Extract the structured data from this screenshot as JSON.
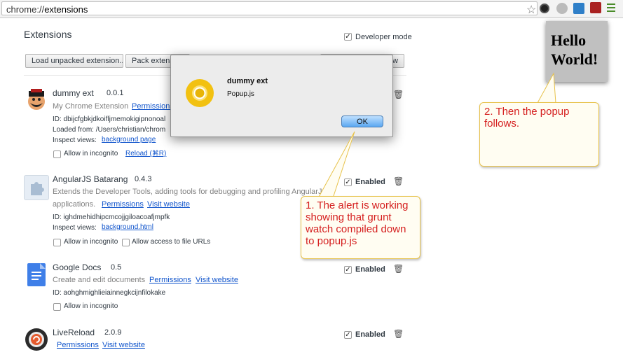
{
  "browser": {
    "url_scheme": "chrome://",
    "url_path": "extensions",
    "star_icon": "bookmark-star-icon",
    "menu_icon": "hamburger-menu-icon"
  },
  "page": {
    "title": "Extensions",
    "developer_mode_label": "Developer mode",
    "developer_mode_checked": true,
    "buttons": {
      "load_unpacked": "Load unpacked extension...",
      "pack": "Pack extension..."
    }
  },
  "extensions": {
    "dummy": {
      "name": "dummy ext",
      "version": "0.0.1",
      "description": "My Chrome Extension",
      "permissions_link": "Permissions",
      "id_line": "ID: dbijcfgbkjdkoifljmemokigipnonoal",
      "loaded_from": "Loaded from: /Users/christian/chrom",
      "inspect_label": "Inspect views:",
      "inspect_link": "background page",
      "incognito_label": "Allow in incognito",
      "reload_link": "Reload (⌘R)"
    },
    "batarang": {
      "name": "AngularJS Batarang",
      "version": "0.4.3",
      "description_line1": "Extends the Developer Tools, adding tools for debugging and profiling AngularJS",
      "description_line2": "applications.",
      "permissions_link": "Permissions",
      "website_link": "Visit website",
      "id_line": "ID: ighdmehidhipcmcojjgiloacoafjmpfk",
      "inspect_label": "Inspect views:",
      "inspect_link": "background.html",
      "incognito_label": "Allow in incognito",
      "file_urls_label": "Allow access to file URLs",
      "enabled_label": "Enabled"
    },
    "docs": {
      "name": "Google Docs",
      "version": "0.5",
      "description": "Create and edit documents",
      "permissions_link": "Permissions",
      "website_link": "Visit website",
      "id_line": "ID: aohghmighlieiainnegkcijnfilokake",
      "incognito_label": "Allow in incognito",
      "enabled_label": "Enabled"
    },
    "livereload": {
      "name": "LiveReload",
      "version": "2.0.9",
      "permissions_link": "Permissions",
      "website_link": "Visit website",
      "enabled_label": "Enabled"
    }
  },
  "alert": {
    "title": "dummy ext",
    "message": "Popup.js",
    "ok_label": "OK"
  },
  "popup": {
    "line1": "Hello",
    "line2": "World!"
  },
  "annotations": {
    "callout1": "1. The alert is working showing that grunt watch compiled down to popup.js",
    "callout2": "2. Then the popup follows.",
    "text_color": "#d51f1f"
  }
}
